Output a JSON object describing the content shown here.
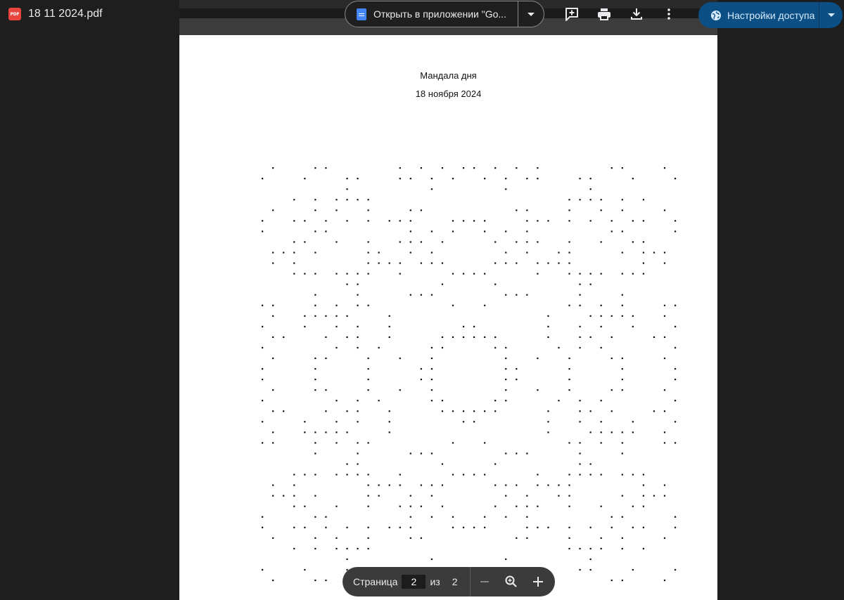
{
  "file": {
    "name": "18 11 2024.pdf",
    "badge": "PDF"
  },
  "toolbar": {
    "open_with_label": "Открыть в приложении \"Go...",
    "share_label": "Настройки доступа"
  },
  "document": {
    "title": "Мандала дня",
    "date": "18 ноября 2024"
  },
  "pager": {
    "label": "Страница",
    "current": "2",
    "of_label": "из",
    "total": "2"
  }
}
